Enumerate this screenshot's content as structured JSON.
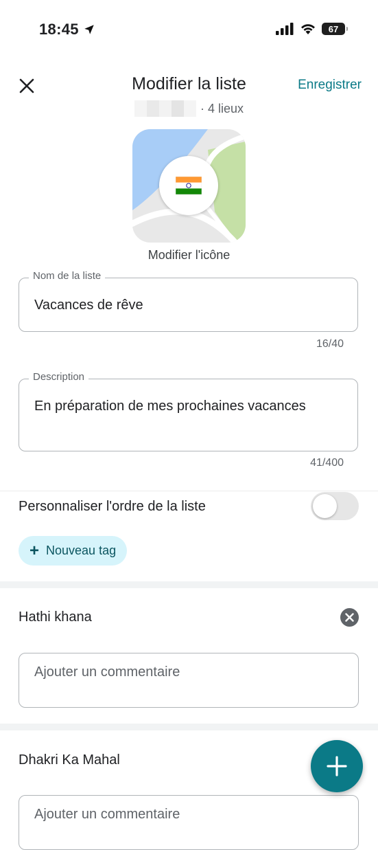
{
  "status_bar": {
    "time": "18:45",
    "battery": "67"
  },
  "header": {
    "title": "Modifier la liste",
    "save_label": "Enregistrer",
    "place_count": "· 4 lieux"
  },
  "list_icon": {
    "flag": "🇮🇳",
    "edit_label": "Modifier l'icône"
  },
  "name_field": {
    "label": "Nom de la liste",
    "value": "Vacances de rêve",
    "counter": "16/40"
  },
  "description_field": {
    "label": "Description",
    "value": "En préparation de mes prochaines vacances",
    "counter": "41/400"
  },
  "custom_order": {
    "label": "Personnaliser l'ordre de la liste",
    "enabled": false
  },
  "new_tag": {
    "label": "Nouveau tag"
  },
  "places": [
    {
      "name": "Hathi khana",
      "comment_placeholder": "Ajouter un commentaire"
    },
    {
      "name": "Dhakri Ka Mahal",
      "comment_placeholder": "Ajouter un commentaire"
    }
  ],
  "colors": {
    "accent": "#0b7a87",
    "chip_bg": "#d6f4fb",
    "map_water": "#a8cdf7",
    "map_park": "#c5e0a6"
  }
}
